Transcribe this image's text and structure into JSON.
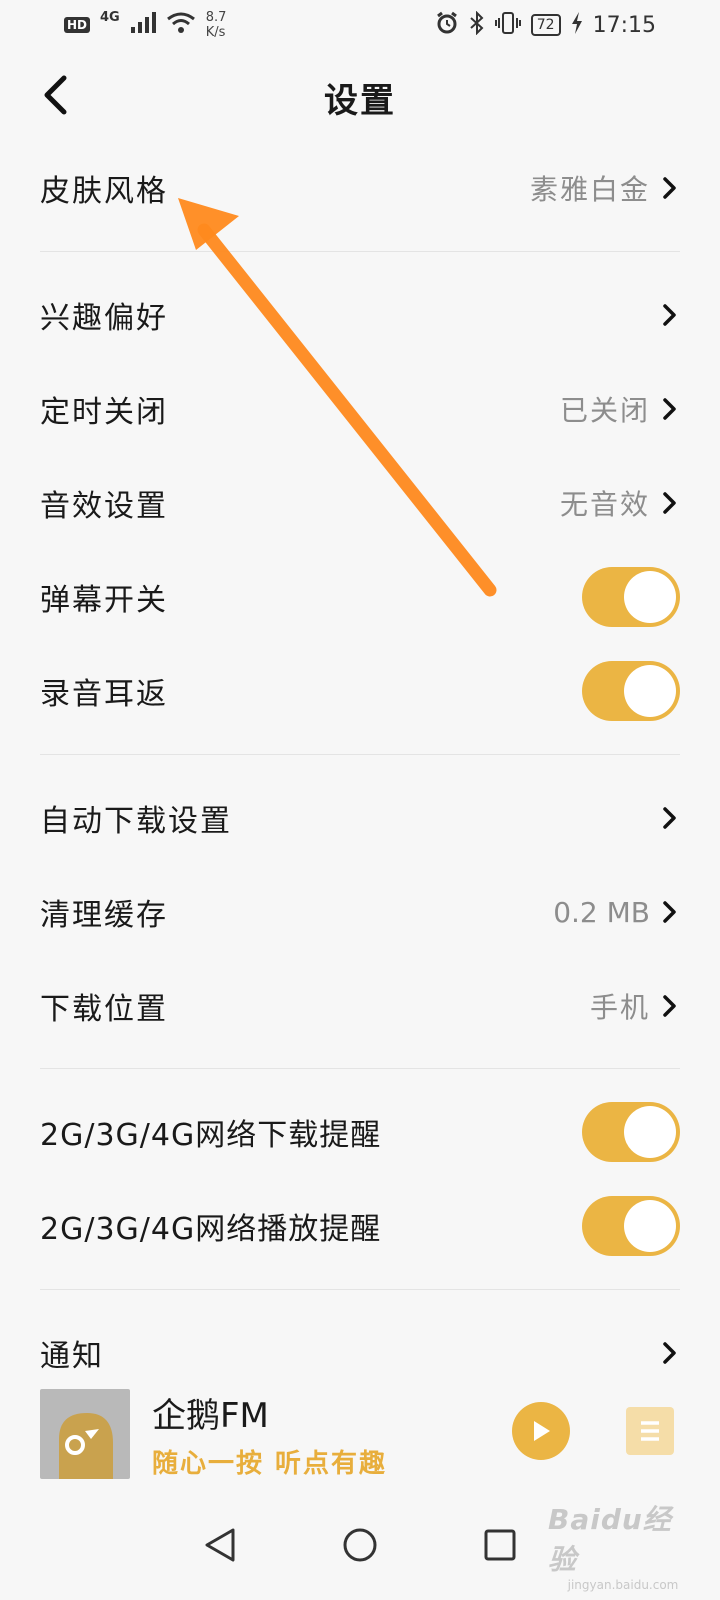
{
  "status_bar": {
    "hd": "HD",
    "network": "4G",
    "speed_value": "8.7",
    "speed_unit": "K/s",
    "battery": "72",
    "time": "17:15"
  },
  "header": {
    "title": "设置"
  },
  "settings": {
    "skin": {
      "label": "皮肤风格",
      "value": "素雅白金"
    },
    "interests": {
      "label": "兴趣偏好"
    },
    "timer": {
      "label": "定时关闭",
      "value": "已关闭"
    },
    "sound_effect": {
      "label": "音效设置",
      "value": "无音效"
    },
    "danmaku": {
      "label": "弹幕开关",
      "on": true
    },
    "ear_return": {
      "label": "录音耳返",
      "on": true
    },
    "auto_download": {
      "label": "自动下载设置"
    },
    "clear_cache": {
      "label": "清理缓存",
      "value": "0.2 MB"
    },
    "download_location": {
      "label": "下载位置",
      "value": "手机"
    },
    "mobile_download_alert": {
      "label": "2G/3G/4G网络下载提醒",
      "on": true
    },
    "mobile_play_alert": {
      "label": "2G/3G/4G网络播放提醒",
      "on": true
    },
    "notifications": {
      "label": "通知"
    }
  },
  "player": {
    "title": "企鹅FM",
    "slogan": "随心一按 听点有趣"
  },
  "watermark": {
    "logo": "Baidu经验",
    "url": "jingyan.baidu.com"
  },
  "colors": {
    "accent": "#ebb544",
    "annotation": "#ff8a1e",
    "value_text": "#8d8d8d"
  }
}
